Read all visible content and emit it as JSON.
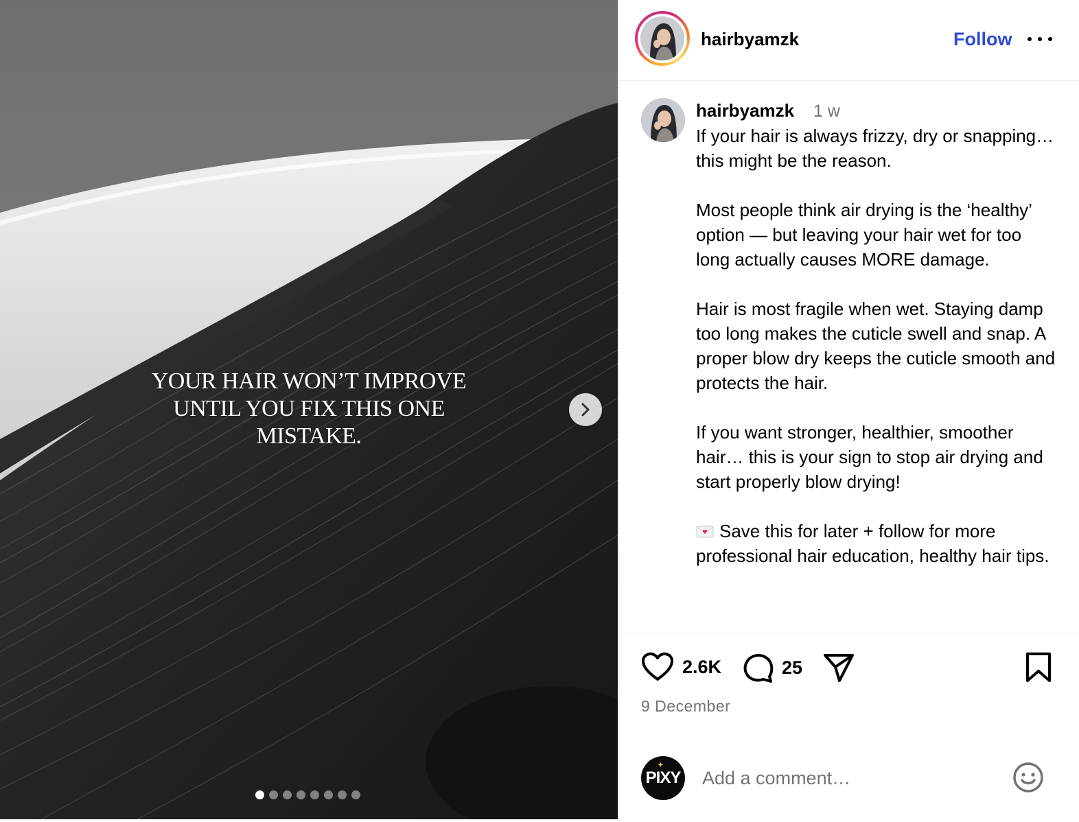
{
  "post": {
    "overlay_text": "YOUR HAIR WON’T IMPROVE UNTIL YOU FIX THIS ONE MISTAKE.",
    "carousel": {
      "total_slides": 8,
      "active_index": 0
    }
  },
  "header": {
    "username": "hairbyamzk",
    "follow_label": "Follow"
  },
  "caption": {
    "username": "hairbyamzk",
    "time_ago": "1 w",
    "paragraphs": [
      "If your hair is always frizzy, dry or snapping… this might be the reason.",
      "Most people think air drying is the ‘healthy’ option — but leaving your hair wet for too long actually causes MORE damage.",
      "Hair is most fragile when wet. Staying damp too long makes the cuticle swell and snap. A proper blow dry keeps the cuticle smooth and protects the hair.",
      "If you want stronger, healthier, smoother hair… this is your sign to stop air drying and start properly blow drying!",
      "Save this for later + follow for more professional hair education, healthy hair tips."
    ]
  },
  "actions": {
    "likes": "2.6K",
    "comments": "25"
  },
  "date": "9 December",
  "comment_box": {
    "avatar_text": "PIXY",
    "placeholder": "Add a comment…"
  },
  "colors": {
    "follow_blue": "#2e4bd6",
    "muted_text": "#737373"
  },
  "icons": [
    "chevron-right-icon",
    "more-icon",
    "heart-icon",
    "comment-icon",
    "share-icon",
    "bookmark-icon",
    "emoji-icon",
    "envelope-icon"
  ]
}
